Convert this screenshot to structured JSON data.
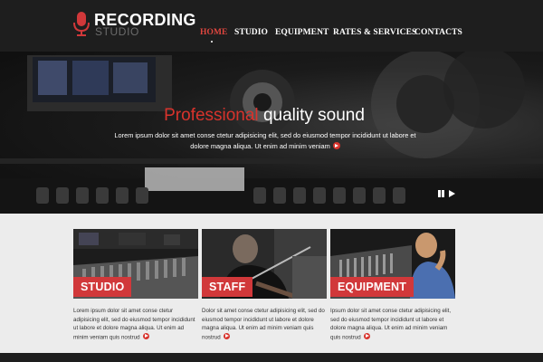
{
  "logo": {
    "title": "RECORDING",
    "subtitle": "STUDIO",
    "icon": "microphone-icon"
  },
  "nav": {
    "items": [
      "HOME",
      "STUDIO",
      "EQUIPMENT",
      "RATES & SERVICES",
      "CONTACTS"
    ],
    "active": "HOME"
  },
  "hero": {
    "title_highlight": "Professional",
    "title_rest": "quality sound",
    "text": "Lorem ipsum dolor sit amet conse ctetur adipisicing elit, sed do eiusmod tempor incididunt ut labore et dolore magna aliqua. Ut enim ad minim veniam",
    "controls": [
      "pause-icon",
      "play-icon"
    ]
  },
  "cards": [
    {
      "label": "STUDIO",
      "text": "Lorem ipsum dolor sit amet conse ctetur adipisicing elit, sed do eiusmod tempor incididunt ut labore et dolore magna aliqua. Ut enim ad minim veniam quis nostrud"
    },
    {
      "label": "STAFF",
      "text": "Dolor sit amet conse ctetur adipisicing elit, sed do eiusmod tempor incididunt ut labore et dolore magna aliqua. Ut enim ad minim veniam quis nostrud"
    },
    {
      "label": "EQUIPMENT",
      "text": "Ipsum dolor sit amet conse ctetur adipisicing elit, sed do eiusmod tempor incididunt ut labore et dolore magna aliqua. Ut enim ad minim veniam quis nostrud"
    }
  ],
  "colors": {
    "accent": "#d1383a",
    "header_bg": "#1e1e1e",
    "page_bg": "#ececec"
  }
}
